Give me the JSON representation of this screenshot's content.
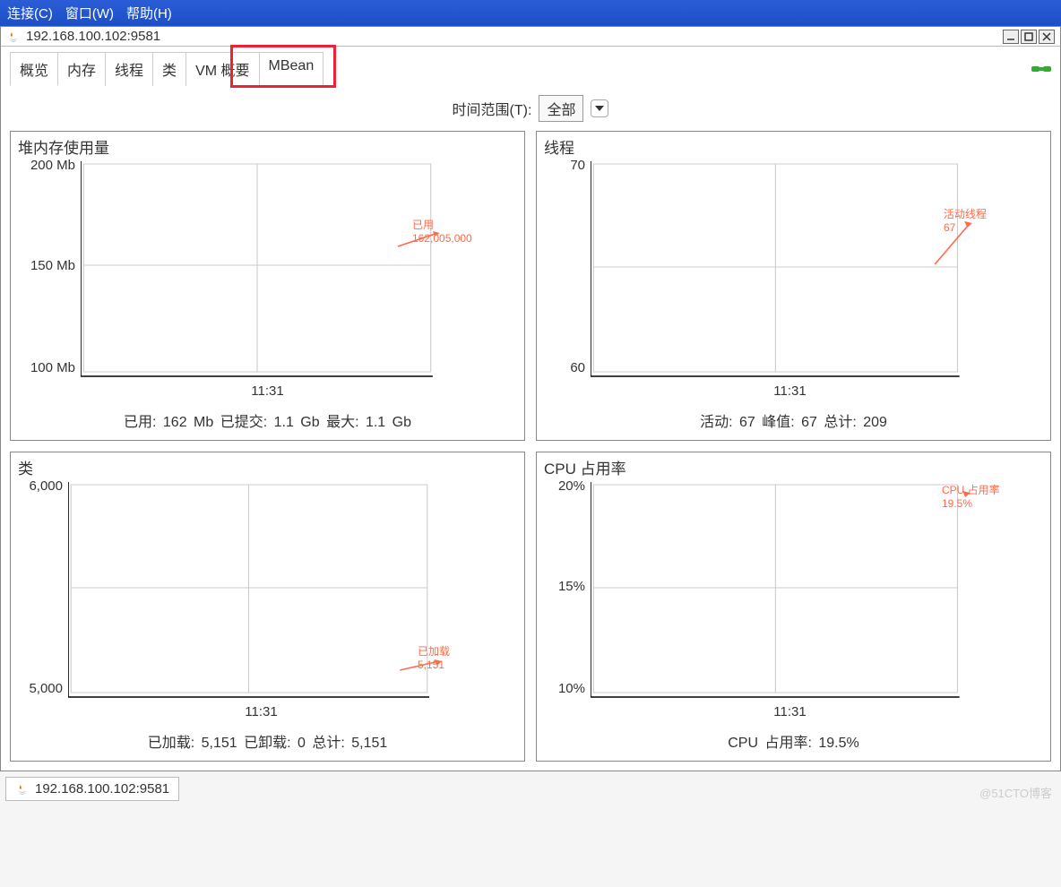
{
  "menubar": {
    "connect": "连接(C)",
    "window": "窗口(W)",
    "help": "帮助(H)"
  },
  "window_title": "192.168.100.102:9581",
  "tabs": {
    "overview": "概览",
    "memory": "内存",
    "threads": "线程",
    "classes": "类",
    "vm_summary": "VM 概要",
    "mbean": "MBean"
  },
  "time_range": {
    "label": "时间范围(T):",
    "value": "全部"
  },
  "chart_data": [
    {
      "type": "line",
      "title": "堆内存使用量",
      "y_ticks": [
        "200 Mb",
        "150 Mb",
        "100 Mb"
      ],
      "ylim": [
        100,
        200
      ],
      "x_tick": "11:31",
      "series": [
        {
          "name": "已用",
          "value_label": "162,005,000",
          "values": [
            162005000
          ]
        }
      ],
      "footer": "已用: 162 Mb   已提交: 1.1 Gb   最大: 1.1 Gb"
    },
    {
      "type": "line",
      "title": "线程",
      "y_ticks": [
        "70",
        "60"
      ],
      "ylim": [
        60,
        70
      ],
      "x_tick": "11:31",
      "series": [
        {
          "name": "活动线程",
          "value_label": "67",
          "values": [
            67
          ]
        }
      ],
      "footer": "活动: 67   峰值: 67   总计: 209"
    },
    {
      "type": "line",
      "title": "类",
      "y_ticks": [
        "6,000",
        "5,000"
      ],
      "ylim": [
        5000,
        6000
      ],
      "x_tick": "11:31",
      "series": [
        {
          "name": "已加载",
          "value_label": "5,151",
          "values": [
            5151
          ]
        }
      ],
      "footer": "已加载: 5,151   已卸载: 0   总计: 5,151"
    },
    {
      "type": "line",
      "title": "CPU 占用率",
      "y_ticks": [
        "20%",
        "15%",
        "10%"
      ],
      "ylim": [
        10,
        20
      ],
      "x_tick": "11:31",
      "series": [
        {
          "name": "CPU 占用率",
          "value_label": "19.5%",
          "values": [
            19.5
          ]
        }
      ],
      "footer": "CPU 占用率: 19.5%"
    }
  ],
  "taskbar_tab": "192.168.100.102:9581",
  "watermark": "@51CTO博客"
}
